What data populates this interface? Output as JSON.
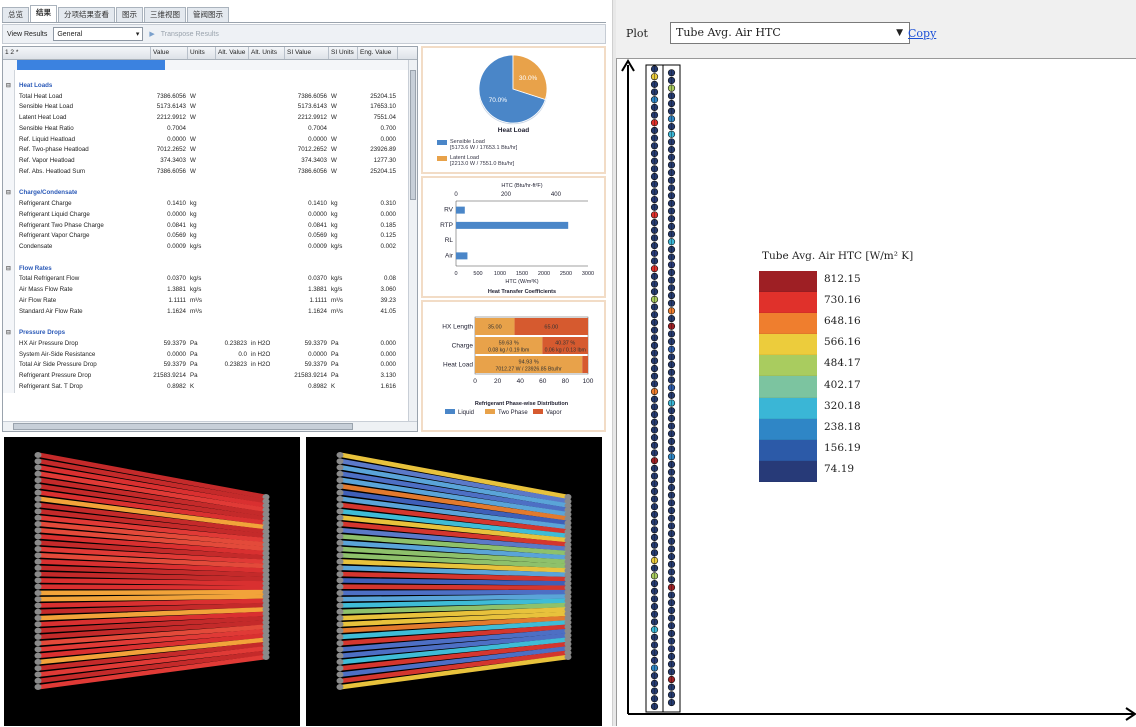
{
  "left_tabs": [
    "总览",
    "结果",
    "分项结果查看",
    "图示",
    "三维视图",
    "管阀图示"
  ],
  "active_tab": 1,
  "toolbar": {
    "view_label": "View Results",
    "view_value": "General",
    "transpose": "Transpose Results"
  },
  "grid": {
    "header": [
      "1 2 *",
      "Value",
      "Units",
      "Alt. Value",
      "Alt. Units",
      "SI Value",
      "SI Units",
      "Eng. Value"
    ],
    "rows": [
      {
        "type": "blank"
      },
      {
        "type": "sec",
        "name": "Heat Loads"
      },
      {
        "name": "Total Heat Load",
        "v": "7386.6056",
        "u": "W",
        "av": "",
        "au": "",
        "sv": "7386.6056",
        "su": "W",
        "ev": "25204.15"
      },
      {
        "name": "Sensible Heat Load",
        "v": "5173.6143",
        "u": "W",
        "av": "",
        "au": "",
        "sv": "5173.6143",
        "su": "W",
        "ev": "17653.10"
      },
      {
        "name": "Latent Heat Load",
        "v": "2212.9912",
        "u": "W",
        "av": "",
        "au": "",
        "sv": "2212.9912",
        "su": "W",
        "ev": "7551.04"
      },
      {
        "name": "Sensible Heat Ratio",
        "v": "0.7004",
        "u": "",
        "av": "",
        "au": "",
        "sv": "0.7004",
        "su": "",
        "ev": "0.700"
      },
      {
        "name": "Ref. Liquid Heatload",
        "v": "0.0000",
        "u": "W",
        "av": "",
        "au": "",
        "sv": "0.0000",
        "su": "W",
        "ev": "0.000"
      },
      {
        "name": "Ref. Two-phase Heatload",
        "v": "7012.2652",
        "u": "W",
        "av": "",
        "au": "",
        "sv": "7012.2652",
        "su": "W",
        "ev": "23926.89"
      },
      {
        "name": "Ref. Vapor Heatload",
        "v": "374.3403",
        "u": "W",
        "av": "",
        "au": "",
        "sv": "374.3403",
        "su": "W",
        "ev": "1277.30"
      },
      {
        "name": "Ref. Abs. Heatload Sum",
        "v": "7386.6056",
        "u": "W",
        "av": "",
        "au": "",
        "sv": "7386.6056",
        "su": "W",
        "ev": "25204.15"
      },
      {
        "type": "blank"
      },
      {
        "type": "sec",
        "name": "Charge/Condensate"
      },
      {
        "name": "Refrigerant Charge",
        "v": "0.1410",
        "u": "kg",
        "av": "",
        "au": "",
        "sv": "0.1410",
        "su": "kg",
        "ev": "0.310"
      },
      {
        "name": "Refrigerant Liquid Charge",
        "v": "0.0000",
        "u": "kg",
        "av": "",
        "au": "",
        "sv": "0.0000",
        "su": "kg",
        "ev": "0.000"
      },
      {
        "name": "Refrigerant Two Phase Charge",
        "v": "0.0841",
        "u": "kg",
        "av": "",
        "au": "",
        "sv": "0.0841",
        "su": "kg",
        "ev": "0.185"
      },
      {
        "name": "Refrigerant Vapor Charge",
        "v": "0.0569",
        "u": "kg",
        "av": "",
        "au": "",
        "sv": "0.0569",
        "su": "kg",
        "ev": "0.125"
      },
      {
        "name": "Condensate",
        "v": "0.0009",
        "u": "kg/s",
        "av": "",
        "au": "",
        "sv": "0.0009",
        "su": "kg/s",
        "ev": "0.002"
      },
      {
        "type": "blank"
      },
      {
        "type": "sec",
        "name": "Flow Rates"
      },
      {
        "name": "Total Refrigerant Flow",
        "v": "0.0370",
        "u": "kg/s",
        "av": "",
        "au": "",
        "sv": "0.0370",
        "su": "kg/s",
        "ev": "0.08"
      },
      {
        "name": "Air Mass Flow Rate",
        "v": "1.3881",
        "u": "kg/s",
        "av": "",
        "au": "",
        "sv": "1.3881",
        "su": "kg/s",
        "ev": "3.060"
      },
      {
        "name": "Air Flow Rate",
        "v": "1.1111",
        "u": "m³/s",
        "av": "",
        "au": "",
        "sv": "1.1111",
        "su": "m³/s",
        "ev": "39.23"
      },
      {
        "name": "Standard Air Flow Rate",
        "v": "1.1624",
        "u": "m³/s",
        "av": "",
        "au": "",
        "sv": "1.1624",
        "su": "m³/s",
        "ev": "41.05"
      },
      {
        "type": "blank"
      },
      {
        "type": "sec",
        "name": "Pressure Drops"
      },
      {
        "name": "HX Air Pressure Drop",
        "v": "59.3379",
        "u": "Pa",
        "av": "0.23823",
        "au": "in H2O",
        "sv": "59.3379",
        "su": "Pa",
        "ev": "0.000"
      },
      {
        "name": "System Air-Side Resistance",
        "v": "0.0000",
        "u": "Pa",
        "av": "0.0",
        "au": "in H2O",
        "sv": "0.0000",
        "su": "Pa",
        "ev": "0.000"
      },
      {
        "name": "Total Air Side Pressure Drop",
        "v": "59.3379",
        "u": "Pa",
        "av": "0.23823",
        "au": "in H2O",
        "sv": "59.3379",
        "su": "Pa",
        "ev": "0.000"
      },
      {
        "name": "Refrigerant Pressure Drop",
        "v": "21583.9214",
        "u": "Pa",
        "av": "",
        "au": "",
        "sv": "21583.9214",
        "su": "Pa",
        "ev": "3.130"
      },
      {
        "name": "Refrigerant Sat. T Drop",
        "v": "0.8982",
        "u": "K",
        "av": "",
        "au": "",
        "sv": "0.8982",
        "su": "K",
        "ev": "1.616"
      }
    ]
  },
  "pie": {
    "title": "Heat Load",
    "slices": [
      {
        "label": "70.0%",
        "value": 70.0,
        "color": "#4a86c8"
      },
      {
        "label": "30.0%",
        "value": 30.0,
        "color": "#e8a24a"
      }
    ],
    "legend": [
      {
        "line1": "Sensible Load",
        "line2": "[5173.6 W / 17653.1 Btu/hr]",
        "color": "#4a86c8"
      },
      {
        "line1": "Latent Load",
        "line2": "[2213.0 W / 7551.0 Btu/hr]",
        "color": "#e8a24a"
      }
    ]
  },
  "htc": {
    "title": "Heat Transfer Coefficients",
    "top_axis_label": "HTC (Btu/hr-ft²F)",
    "top_ticks": [
      "0",
      "200",
      "400"
    ],
    "bottom_axis_label": "HTC (W/m²K)",
    "bottom_ticks": [
      "0",
      "500",
      "1000",
      "1500",
      "2000",
      "2500",
      "3000"
    ],
    "xlim": [
      0,
      3000
    ],
    "categories": [
      "RV",
      "RTP",
      "RL",
      "Air"
    ],
    "values": [
      200,
      2550,
      0,
      260
    ],
    "color": "#4a86c8"
  },
  "phase": {
    "title": "Refrigerant Phase-wise Distribution",
    "categories": [
      "HX Length",
      "Charge",
      "Heat Load"
    ],
    "segments": [
      [
        {
          "value": 35.0,
          "label": "35.00",
          "color": "#e8a24a"
        },
        {
          "value": 65.0,
          "label": "65.00",
          "color": "#d65a2f"
        }
      ],
      [
        {
          "value": 59.63,
          "label": "59.63 %",
          "label2": "0.08 kg / 0.19 lbm",
          "color": "#e8a24a"
        },
        {
          "value": 40.37,
          "label": "40.37 %",
          "label2": "0.06 kg / 0.13 lbm",
          "color": "#d65a2f"
        }
      ],
      [
        {
          "value": 94.93,
          "label": "94.93 %",
          "label2": "7012.27 W / 23926.85 Btu/hr",
          "color": "#e8a24a"
        },
        {
          "value": 5.07,
          "label": "",
          "label2": "",
          "color": "#d65a2f"
        }
      ]
    ],
    "ticks": [
      "0",
      "20",
      "40",
      "60",
      "80",
      "100"
    ],
    "legend": [
      {
        "name": "Liquid",
        "color": "#4a86c8"
      },
      {
        "name": "Two Phase",
        "color": "#e8a24a"
      },
      {
        "name": "Vapor",
        "color": "#d65a2f"
      }
    ]
  },
  "right": {
    "plot_label": "Plot",
    "plot_value": "Tube Avg. Air HTC",
    "copy_label": "Copy",
    "legend_title": "Tube Avg. Air HTC [W/m² K]",
    "legend_values": [
      "812.15",
      "730.16",
      "648.16",
      "566.16",
      "484.17",
      "402.17",
      "320.18",
      "238.18",
      "156.19",
      "74.19"
    ],
    "legend_colors": [
      "#9e1f24",
      "#e0312b",
      "#ef7e2e",
      "#eccc3c",
      "#a9cc5f",
      "#7cc4a0",
      "#3ab6d6",
      "#2f86c6",
      "#2c5aa8",
      "#273a78"
    ]
  },
  "colors": {
    "accent": "#3b82e0",
    "section": "#2b5ab8"
  }
}
